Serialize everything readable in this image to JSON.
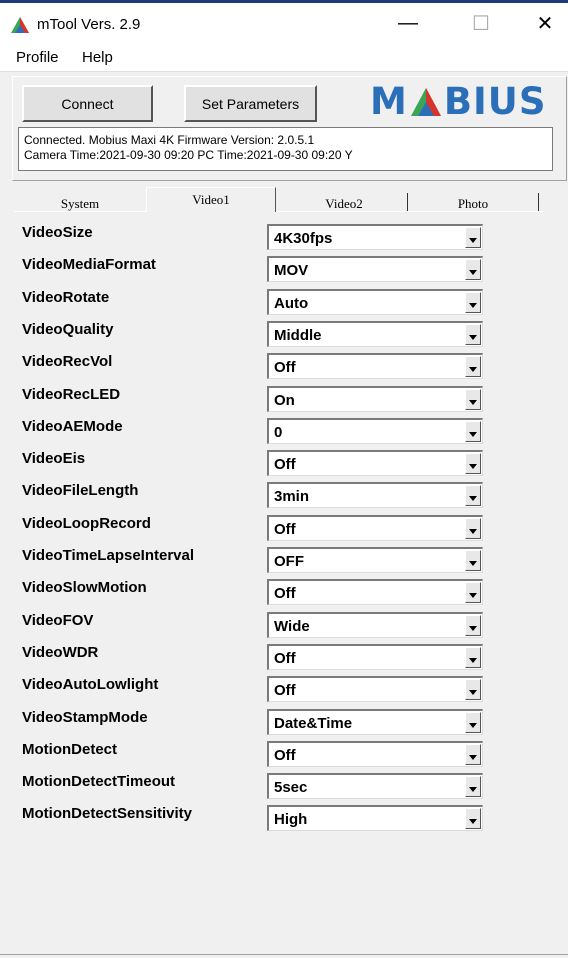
{
  "window": {
    "title": "mTool Vers. 2.9",
    "min_glyph": "—",
    "max_glyph": "☐",
    "close_glyph": "✕"
  },
  "menu": {
    "profile": "Profile",
    "help": "Help"
  },
  "toolbar": {
    "connect_label": "Connect",
    "set_params_label": "Set Parameters",
    "logo_m": "M",
    "logo_rest": "BIUS"
  },
  "status": {
    "line1": "Connected. Mobius Maxi 4K Firmware Version: 2.0.5.1",
    "line2": "Camera Time:2021-09-30 09:20  PC Time:2021-09-30 09:20  Y"
  },
  "tabs": [
    {
      "label": "System"
    },
    {
      "label": "Video1"
    },
    {
      "label": "Video2"
    },
    {
      "label": "Photo"
    }
  ],
  "settings": [
    {
      "label": "VideoSize",
      "value": "4K30fps"
    },
    {
      "label": "VideoMediaFormat",
      "value": "MOV"
    },
    {
      "label": "VideoRotate",
      "value": "Auto"
    },
    {
      "label": "VideoQuality",
      "value": "Middle"
    },
    {
      "label": "VideoRecVol",
      "value": "Off"
    },
    {
      "label": "VideoRecLED",
      "value": "On"
    },
    {
      "label": "VideoAEMode",
      "value": "0"
    },
    {
      "label": "VideoEis",
      "value": "Off"
    },
    {
      "label": "VideoFileLength",
      "value": "3min"
    },
    {
      "label": "VideoLoopRecord",
      "value": "Off"
    },
    {
      "label": "VideoTimeLapseInterval",
      "value": "OFF"
    },
    {
      "label": "VideoSlowMotion",
      "value": "Off"
    },
    {
      "label": "VideoFOV",
      "value": "Wide"
    },
    {
      "label": "VideoWDR",
      "value": "Off"
    },
    {
      "label": "VideoAutoLowlight",
      "value": "Off"
    },
    {
      "label": "VideoStampMode",
      "value": "Date&Time"
    },
    {
      "label": "MotionDetect",
      "value": "Off"
    },
    {
      "label": "MotionDetectTimeout",
      "value": "5sec"
    },
    {
      "label": "MotionDetectSensitivity",
      "value": "High"
    }
  ],
  "colors": {
    "logo_blue": "#2b6fb9",
    "logo_red": "#d9342b",
    "logo_green": "#3aa655"
  }
}
